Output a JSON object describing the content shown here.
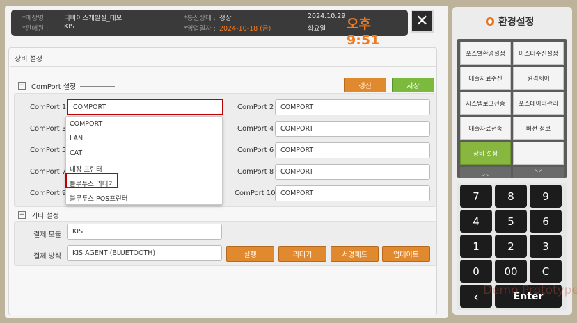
{
  "header": {
    "store_label": "*매장명 :",
    "store_value": "디바이스개발실_데모",
    "seller_label": "*판매원 :",
    "seller_value": "KIS",
    "comm_label": "*통신상태 :",
    "comm_value": "정상",
    "bizdate_label": "*영업일자 :",
    "bizdate_value": "2024-10-18 (금)",
    "date": "2024.10.29",
    "weekday": "화요일",
    "clock": "오후 9:51",
    "close_icon": "close-icon"
  },
  "panel": {
    "title": "장비 설정",
    "comport_section": "ComPort 설정",
    "refresh_label": "갱신",
    "save_label": "저장",
    "ports": [
      {
        "label": "ComPort 1",
        "value": "COMPORT"
      },
      {
        "label": "ComPort 2",
        "value": "COMPORT"
      },
      {
        "label": "ComPort 3",
        "value": ""
      },
      {
        "label": "ComPort 4",
        "value": "COMPORT"
      },
      {
        "label": "ComPort 5",
        "value": ""
      },
      {
        "label": "ComPort 6",
        "value": "COMPORT"
      },
      {
        "label": "ComPort 7",
        "value": ""
      },
      {
        "label": "ComPort 8",
        "value": "COMPORT"
      },
      {
        "label": "ComPort 9",
        "value": ""
      },
      {
        "label": "ComPort 10",
        "value": "COMPORT"
      }
    ],
    "dropdown_options": [
      "COMPORT",
      "LAN",
      "CAT",
      "내장 프린터",
      "블루투스 리더기",
      "블루투스 POS프린터"
    ],
    "etc_section": "기타 설정",
    "payment_module_label": "결제 모듈",
    "payment_module_value": "KIS",
    "payment_method_label": "결제 방식",
    "payment_method_value": "KIS AGENT (BLUETOOTH)",
    "run_label": "실행",
    "reader_label": "리더기",
    "signpad_label": "서명패드",
    "update_label": "업데이트"
  },
  "side": {
    "title": "환경설정",
    "menu": [
      "포스별환경설정",
      "마스터수신설정",
      "매출자료수신",
      "원격제어",
      "시스템로그전송",
      "포스데이터관리",
      "매출자료전송",
      "버전 정보",
      "장비 설정",
      ""
    ],
    "up_arrow": "︿",
    "down_arrow": "﹀",
    "keys": [
      "7",
      "8",
      "9",
      "4",
      "5",
      "6",
      "1",
      "2",
      "3",
      "0",
      "00",
      "C"
    ],
    "back_key": "‹",
    "enter_key": "Enter"
  },
  "watermark": "Demo Prototype",
  "colors": {
    "accent": "#e0892e",
    "active": "#88b740",
    "highlight": "#c00000",
    "clock": "#f07a22"
  }
}
